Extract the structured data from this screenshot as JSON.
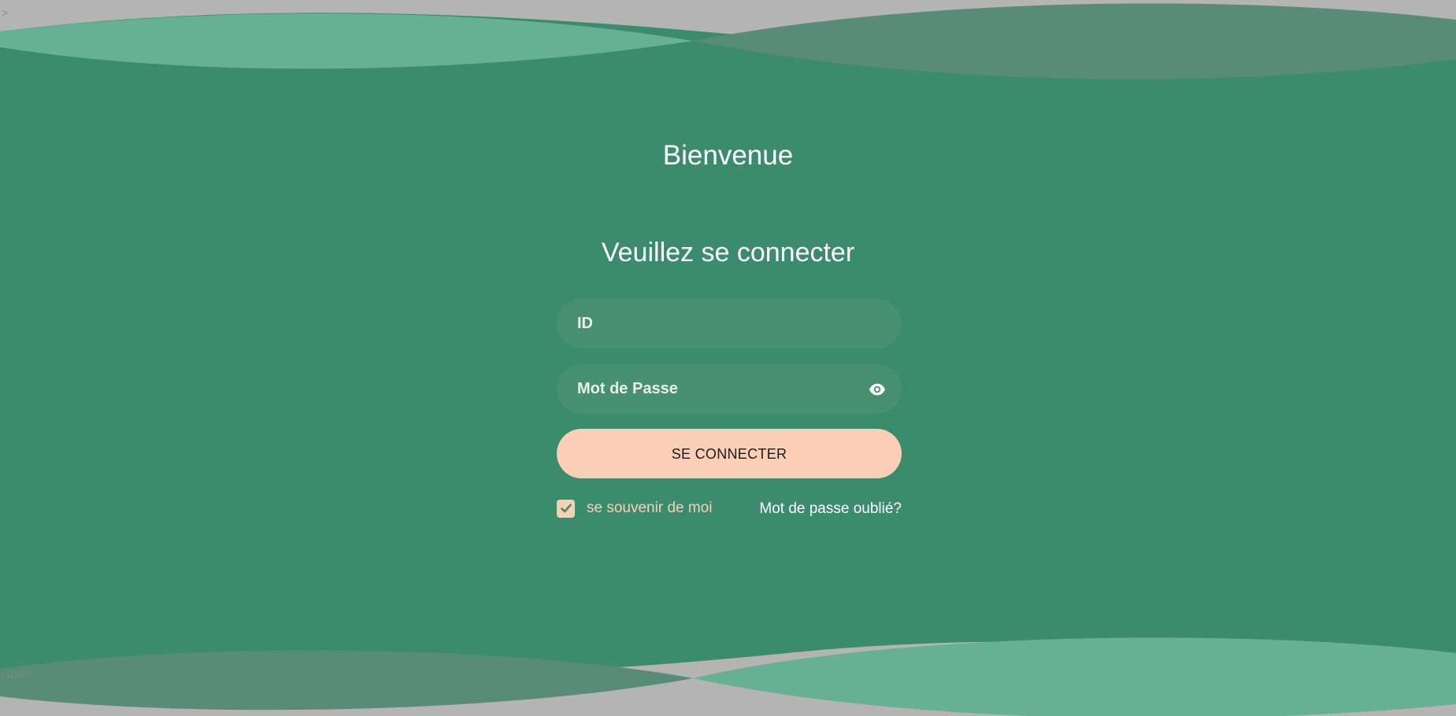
{
  "header": {
    "welcome": "Bienvenue",
    "subtitle": "Veuillez se connecter"
  },
  "form": {
    "id_placeholder": "ID",
    "id_value": "",
    "password_placeholder": "Mot de Passe",
    "password_value": "",
    "password_toggle_icon": "eye-icon",
    "submit_label": "SE CONNECTER",
    "remember_label": "se souvenir de moi",
    "remember_checked": true,
    "forgot_label": "Mot de passe oublié?"
  },
  "stray_text": {
    "top": ">",
    "bottom": "</div>"
  },
  "colors": {
    "background": "#3b8c6c",
    "wave_light": "#66b193",
    "wave_dark": "#588b78",
    "outer": "#b4b4b4",
    "input_bg": "#479072",
    "accent_peach": "#fbcfb6",
    "text_white": "#ffffff"
  }
}
